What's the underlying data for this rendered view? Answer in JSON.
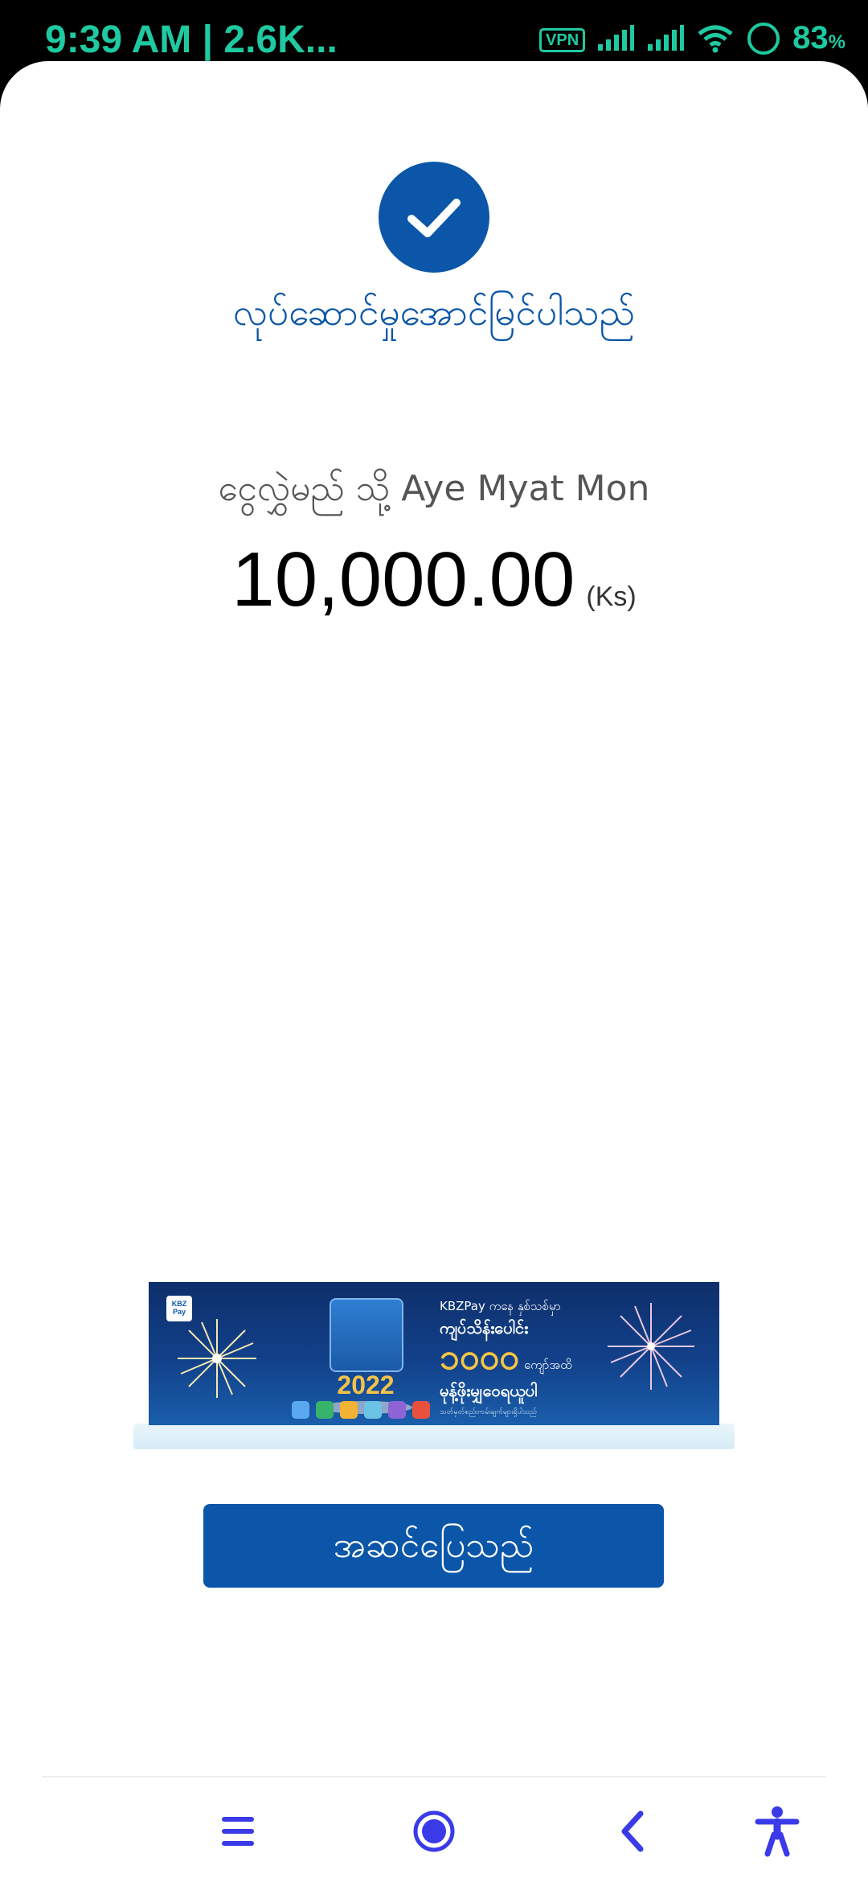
{
  "status_bar": {
    "time_text": "9:39 AM | 2.6K...",
    "vpn_label": "VPN",
    "battery_value": "83",
    "battery_unit": "%"
  },
  "result": {
    "success_message": "လုပ်ဆောင်မှုအောင်မြင်ပါသည်",
    "transfer_to_label": "ငွေလွှဲမည် သို့ Aye Myat Mon",
    "amount": "10,000.00",
    "currency": "(Ks)"
  },
  "banner": {
    "logo_text": "KBZ Pay",
    "year": "2022",
    "line1": "KBZPay ကနေ နှစ်သစ်မှာ",
    "line2": "ကျပ်သိန်းပေါင်း",
    "big_number": "၁၀၀၀",
    "big_unit": "ကျော်အထိ",
    "line4": "မုန့်ဖိုးမျှဝေရယူပါ",
    "line5": "သတ်မှတ်စည်းကမ်းချက်များရှိပါသည်"
  },
  "actions": {
    "done_label": "အဆင်ပြေသည်"
  },
  "nav": {
    "icons": [
      "menu-icon",
      "home-circle-icon",
      "back-chevron-icon",
      "accessibility-icon"
    ],
    "accent_color": "#3A3AE8"
  },
  "colors": {
    "brand_blue": "#0B56A8",
    "status_green": "#1FC9A1"
  }
}
